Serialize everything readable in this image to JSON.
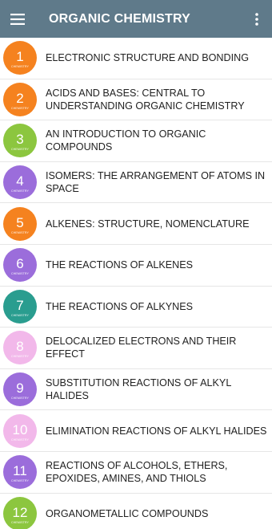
{
  "app_bar": {
    "title": "ORGANIC CHEMISTRY",
    "menu_icon": "hamburger-menu-icon",
    "more_icon": "more-vert-icon",
    "background": "#5f7a8a"
  },
  "badge_caption": "CHEMISTRY",
  "chapters": [
    {
      "number": "1",
      "title": "ELECTRONIC STRUCTURE AND BONDING",
      "color": "#f5821f"
    },
    {
      "number": "2",
      "title": "ACIDS AND BASES: CENTRAL TO UNDERSTANDING ORGANIC CHEMISTRY",
      "color": "#f5821f"
    },
    {
      "number": "3",
      "title": "AN INTRODUCTION TO ORGANIC COMPOUNDS",
      "color": "#8cc63f"
    },
    {
      "number": "4",
      "title": "ISOMERS: THE ARRANGEMENT OF ATOMS IN SPACE",
      "color": "#9b6ddb"
    },
    {
      "number": "5",
      "title": "ALKENES: STRUCTURE, NOMENCLATURE",
      "color": "#f5821f"
    },
    {
      "number": "6",
      "title": "THE REACTIONS OF ALKENES",
      "color": "#9b6ddb"
    },
    {
      "number": "7",
      "title": "THE REACTIONS OF ALKYNES",
      "color": "#2a9d8f"
    },
    {
      "number": "8",
      "title": "DELOCALIZED ELECTRONS AND THEIR EFFECT",
      "color": "#f2b8ea"
    },
    {
      "number": "9",
      "title": "SUBSTITUTION REACTIONS OF ALKYL HALIDES",
      "color": "#9b6ddb"
    },
    {
      "number": "10",
      "title": "ELIMINATION REACTIONS OF ALKYL HALIDES",
      "color": "#f2b8ea"
    },
    {
      "number": "11",
      "title": "REACTIONS OF ALCOHOLS, ETHERS, EPOXIDES, AMINES, AND THIOLS",
      "color": "#9b6ddb"
    },
    {
      "number": "12",
      "title": "ORGANOMETALLIC COMPOUNDS",
      "color": "#8cc63f"
    }
  ]
}
